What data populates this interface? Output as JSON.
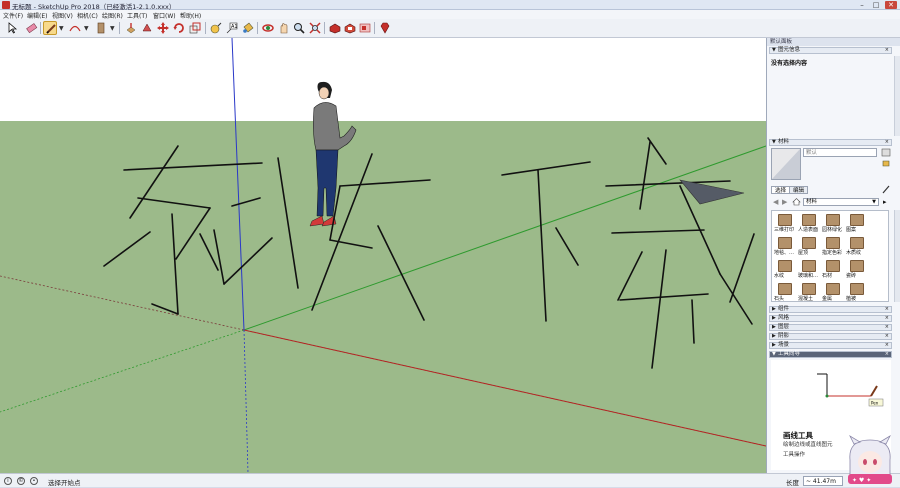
{
  "window": {
    "title": "无标题 - SketchUp Pro 2018（已经激活1-2.1.0.xxx）",
    "minimize": "–",
    "maximize": "□",
    "close": "✕"
  },
  "menu": [
    "文件(F)",
    "编辑(E)",
    "视图(V)",
    "相机(C)",
    "绘图(R)",
    "工具(T)",
    "窗口(W)",
    "帮助(H)"
  ],
  "toolbar": {
    "icons": [
      "select-icon",
      "eraser-icon",
      "pencil-icon",
      "arc-icon",
      "shape-icon",
      "push-pull-icon",
      "offset-icon",
      "move-icon",
      "rotate-icon",
      "scale-icon",
      "tape-measure-icon",
      "text-icon",
      "paint-bucket-icon",
      "orbit-icon",
      "pan-icon",
      "zoom-icon",
      "zoom-extents-icon",
      "3d-warehouse-icon",
      "extension-warehouse-icon",
      "layout-icon",
      "ruby-icon"
    ],
    "active": "pencil-icon"
  },
  "viewport": {
    "sky_color": "#ffffff",
    "ground_color": "#9cba8a",
    "handwriting": "东坡下载",
    "axes": {
      "red": "#b22222",
      "green": "#2e9a2e",
      "blue": "#2a38c8"
    }
  },
  "tray": {
    "header": "默认面板",
    "entity_info": {
      "title": "图元信息",
      "content": "没有选择内容"
    },
    "materials": {
      "title": "材料",
      "name_placeholder": "默认",
      "tab_select": "选择",
      "tab_edit": "编辑",
      "library": "材料",
      "items": [
        "三维打印",
        "人造表面",
        "园林绿化",
        "图案",
        "地毯、…",
        "屋顶",
        "指定色彩",
        "木质纹",
        "水纹",
        "玻璃和…",
        "石材",
        "瓷砖",
        "石头",
        "混凝土",
        "金属",
        "植被"
      ]
    },
    "collapsed_panels": [
      "组件",
      "风格",
      "图层",
      "阴影",
      "场景"
    ],
    "instructor": {
      "title": "工具向导",
      "tool_name": "画线工具",
      "description": "绘制边线或直线图元",
      "more": "工具操作"
    }
  },
  "status": {
    "hint": "选择开始点",
    "measurements_label": "长度",
    "measurements_value": "~ 41.47m"
  }
}
